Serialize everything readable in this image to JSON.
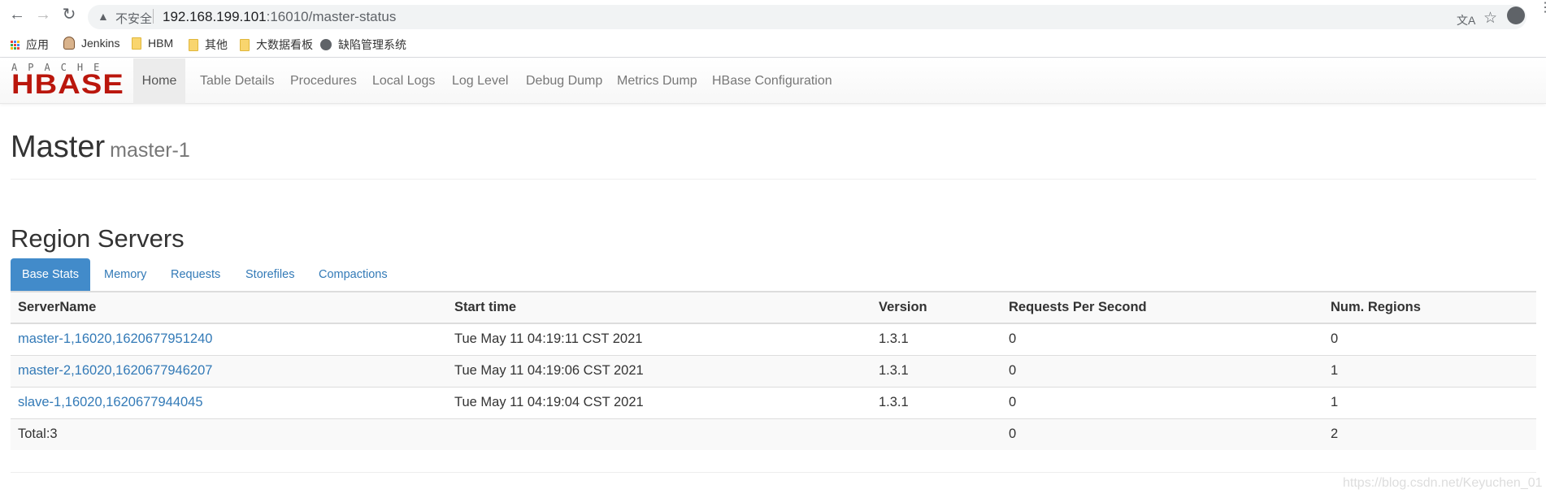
{
  "browser": {
    "insecure_label": "不安全",
    "url_host": "192.168.199.101",
    "url_rest": ":16010/master-status",
    "bookmarks": [
      {
        "label": "应用",
        "icon": "apps-grid-icon"
      },
      {
        "label": "Jenkins",
        "icon": "jenkins-icon"
      },
      {
        "label": "HBM",
        "icon": "folder-icon"
      },
      {
        "label": "其他",
        "icon": "folder-icon"
      },
      {
        "label": "大数据看板",
        "icon": "folder-icon"
      },
      {
        "label": "缺陷管理系统",
        "icon": "globe-icon"
      }
    ]
  },
  "navbar": {
    "logo_top": "APACHE",
    "logo_main": "HBASE",
    "items": [
      "Home",
      "Table Details",
      "Procedures",
      "Local Logs",
      "Log Level",
      "Debug Dump",
      "Metrics Dump",
      "HBase Configuration"
    ]
  },
  "page": {
    "title": "Master",
    "subtitle": "master-1"
  },
  "region_servers": {
    "heading": "Region Servers",
    "tabs": [
      "Base Stats",
      "Memory",
      "Requests",
      "Storefiles",
      "Compactions"
    ],
    "columns": [
      "ServerName",
      "Start time",
      "Version",
      "Requests Per Second",
      "Num. Regions"
    ],
    "rows": [
      [
        "master-1,16020,1620677951240",
        "Tue May 11 04:19:11 CST 2021",
        "1.3.1",
        "0",
        "0"
      ],
      [
        "master-2,16020,1620677946207",
        "Tue May 11 04:19:06 CST 2021",
        "1.3.1",
        "0",
        "1"
      ],
      [
        "slave-1,16020,1620677944045",
        "Tue May 11 04:19:04 CST 2021",
        "1.3.1",
        "0",
        "1"
      ]
    ],
    "total": [
      "Total:3",
      "",
      "",
      "0",
      "2"
    ]
  },
  "watermark": "https://blog.csdn.net/Keyuchen_01",
  "colors": {
    "accent": "#428bca",
    "link": "#337ab7",
    "logo_red": "#ba160c"
  }
}
